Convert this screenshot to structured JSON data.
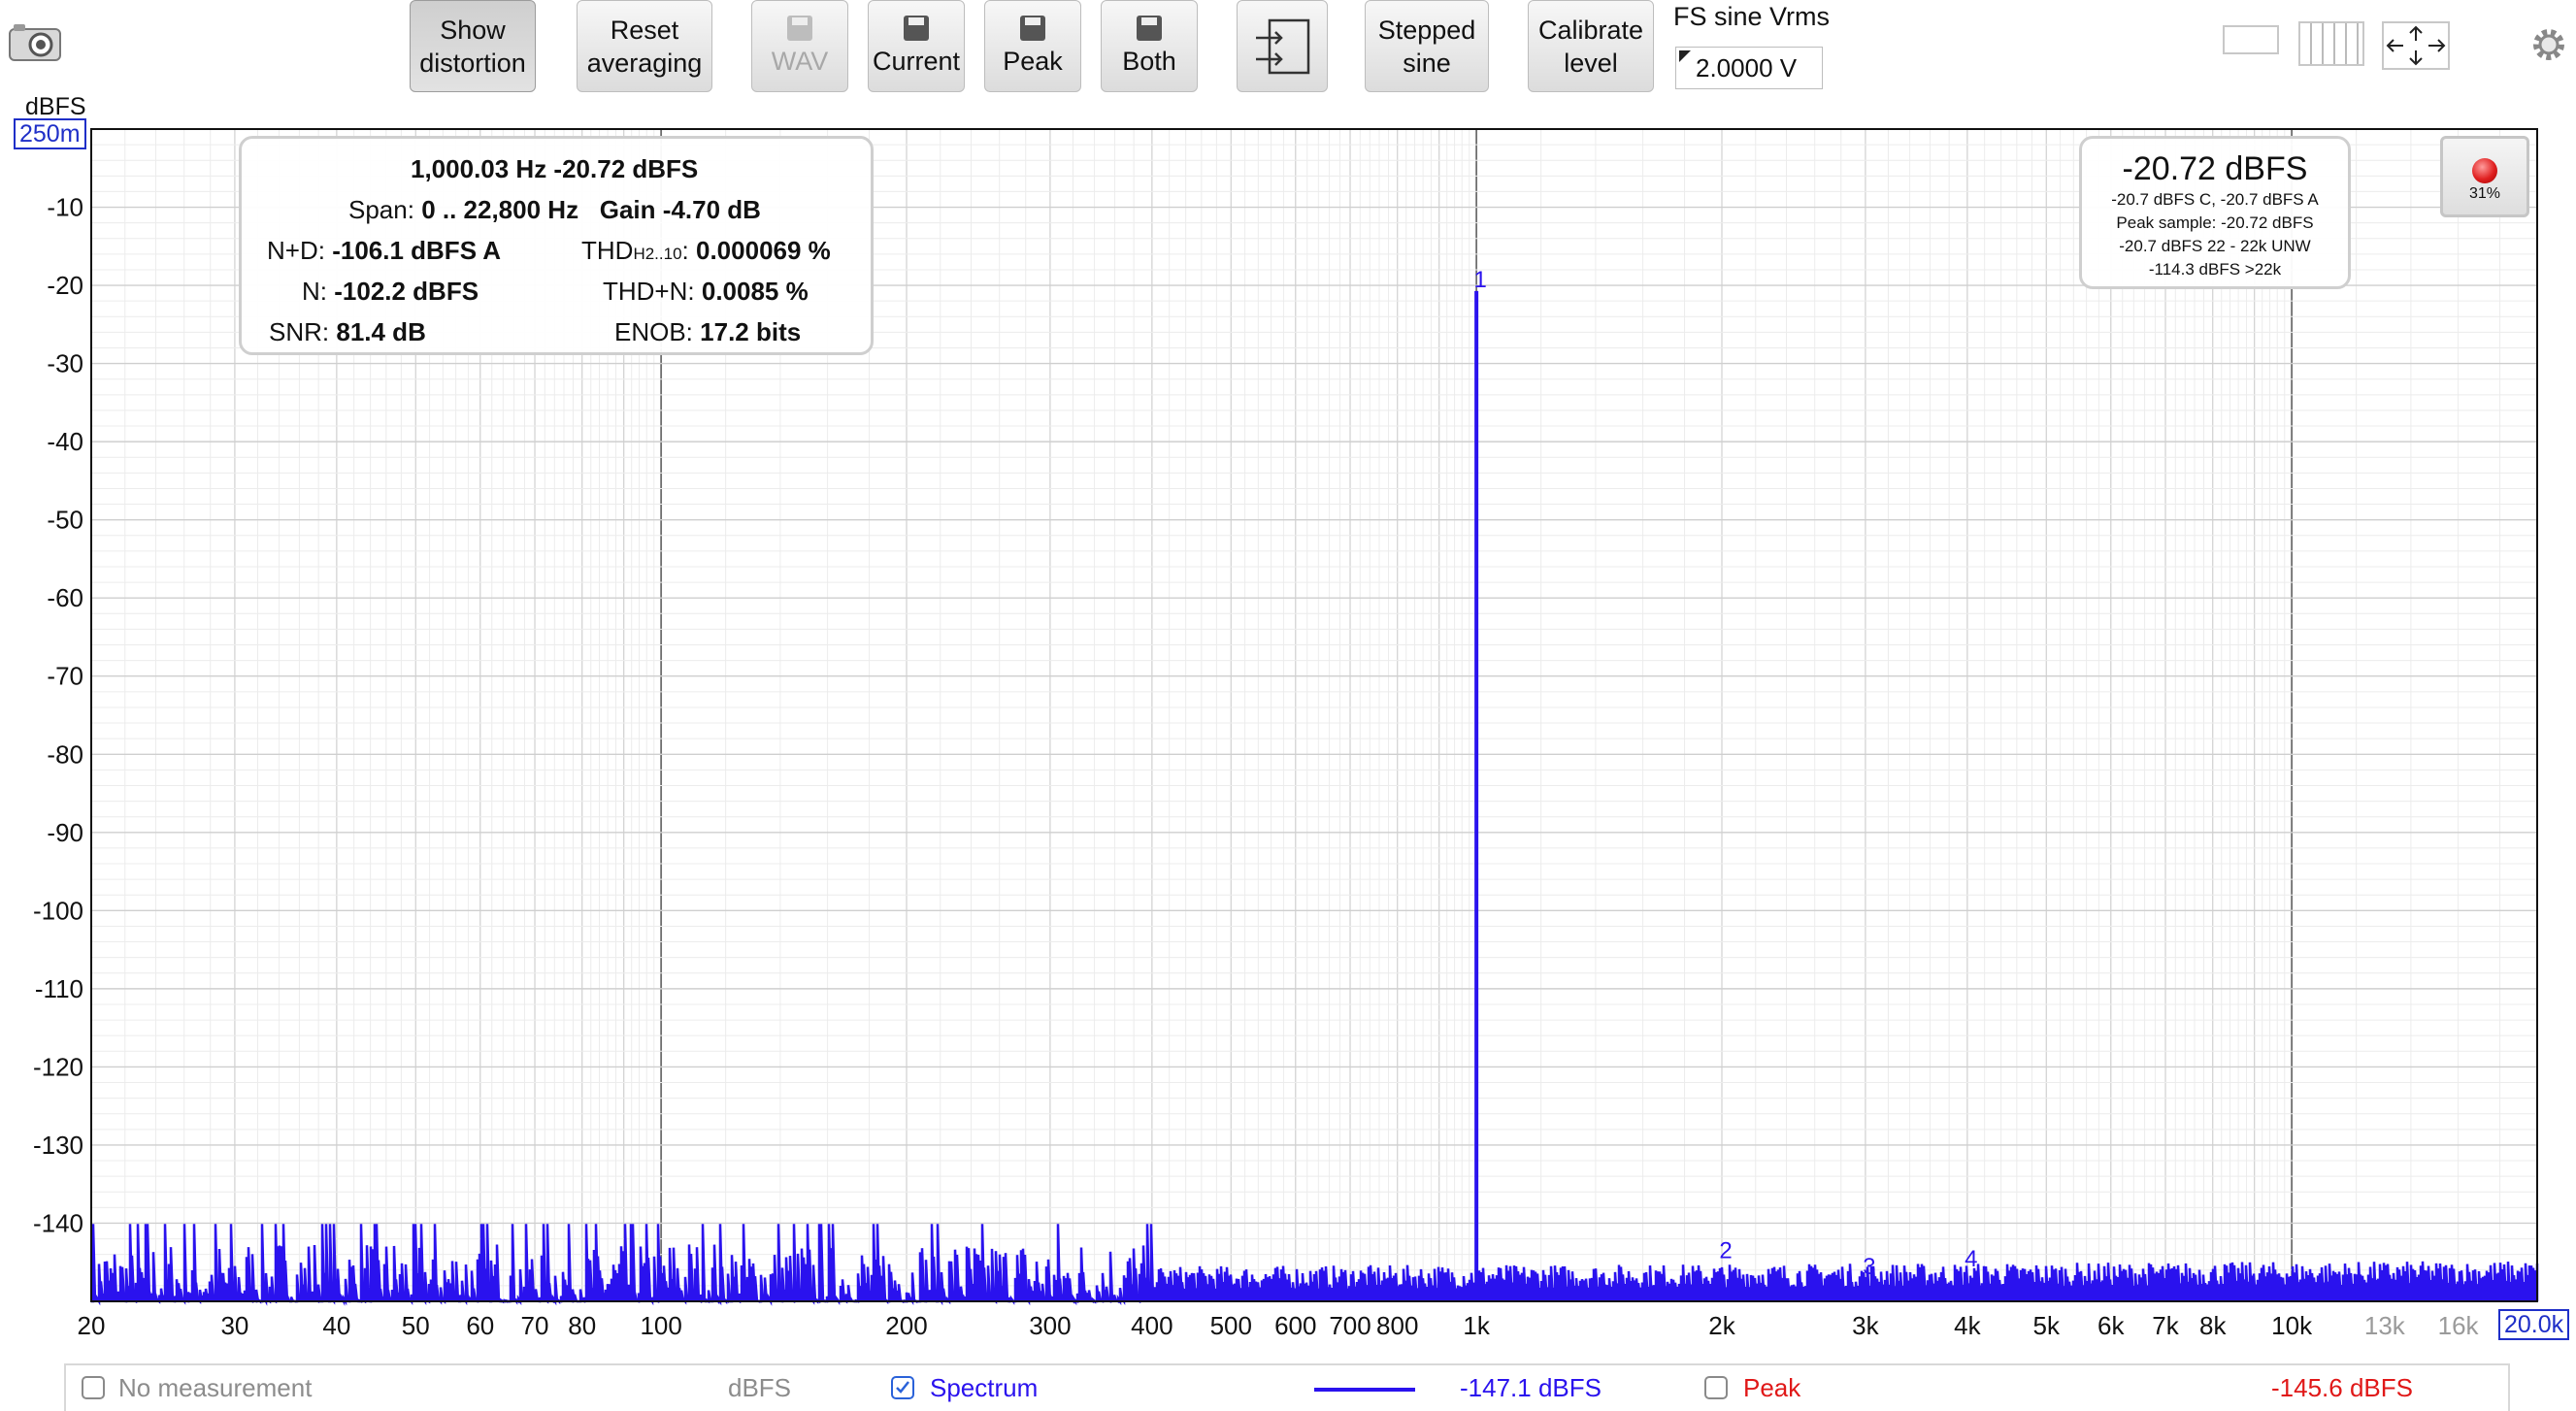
{
  "toolbar": {
    "show_distortion": [
      "Show",
      "distortion"
    ],
    "reset_averaging": [
      "Reset",
      "averaging"
    ],
    "wav_label": "WAV",
    "current_label": "Current",
    "peak_label": "Peak",
    "both_label": "Both",
    "stepped_sine": [
      "Stepped",
      "sine"
    ],
    "calibrate_level": [
      "Calibrate",
      "level"
    ],
    "fs_label": "FS sine Vrms",
    "fs_value": "2.0000 V"
  },
  "stats": {
    "freq_level": "1,000.03 Hz  -20.72 dBFS",
    "span_label": "Span:",
    "span_value": "0 .. 22,800 Hz",
    "gain_label": "Gain",
    "gain_value": "-4.70 dB",
    "nd_label": "N+D:",
    "nd_value": "-106.1 dBFS A",
    "thd_label_main": "THD",
    "thd_label_sub": "H2..10",
    "thd_label_colon": ":",
    "thd_value": "0.000069 %",
    "n_label": "N:",
    "n_value": "-102.2 dBFS",
    "thdn_label": "THD+N:",
    "thdn_value": "0.0085 %",
    "snr_label": "SNR:",
    "snr_value": "81.4 dB",
    "enob_label": "ENOB:",
    "enob_value": "17.2 bits"
  },
  "level_panel": {
    "main": "-20.72 dBFS",
    "line1": "-20.7 dBFS C, -20.7 dBFS A",
    "line2": "Peak sample: -20.72 dBFS",
    "line3": "-20.7 dBFS 22 - 22k UNW",
    "line4": "-114.3 dBFS >22k"
  },
  "record": {
    "percent": "31%",
    "color": "#e02020"
  },
  "chart_data": {
    "type": "line",
    "title": "",
    "ylabel": "dBFS",
    "y_top_label": "250m",
    "x_end_label": "20.0k",
    "x_scale": "log",
    "xlim": [
      20,
      20000
    ],
    "ylim": [
      -150,
      0
    ],
    "y_ticks": [
      -10,
      -20,
      -30,
      -40,
      -50,
      -60,
      -70,
      -80,
      -90,
      -100,
      -110,
      -120,
      -130,
      -140
    ],
    "x_ticks": [
      {
        "v": 20,
        "label": "20"
      },
      {
        "v": 30,
        "label": "30"
      },
      {
        "v": 40,
        "label": "40"
      },
      {
        "v": 50,
        "label": "50"
      },
      {
        "v": 60,
        "label": "60"
      },
      {
        "v": 70,
        "label": "70"
      },
      {
        "v": 80,
        "label": "80"
      },
      {
        "v": 100,
        "label": "100"
      },
      {
        "v": 200,
        "label": "200"
      },
      {
        "v": 300,
        "label": "300"
      },
      {
        "v": 400,
        "label": "400"
      },
      {
        "v": 500,
        "label": "500"
      },
      {
        "v": 600,
        "label": "600"
      },
      {
        "v": 700,
        "label": "700"
      },
      {
        "v": 800,
        "label": "800"
      },
      {
        "v": 1000,
        "label": "1k"
      },
      {
        "v": 2000,
        "label": "2k"
      },
      {
        "v": 3000,
        "label": "3k"
      },
      {
        "v": 4000,
        "label": "4k"
      },
      {
        "v": 5000,
        "label": "5k"
      },
      {
        "v": 6000,
        "label": "6k"
      },
      {
        "v": 7000,
        "label": "7k"
      },
      {
        "v": 8000,
        "label": "8k"
      },
      {
        "v": 10000,
        "label": "10k"
      },
      {
        "v": 13000,
        "label": "13k"
      },
      {
        "v": 16000,
        "label": "16k"
      }
    ],
    "grid": true,
    "series": [
      {
        "name": "Spectrum",
        "color": "#2a12ee",
        "noise_floor": -147.1,
        "peaks": [
          {
            "x": 1000,
            "y": -20.72
          }
        ]
      }
    ],
    "harmonic_markers": [
      {
        "label": "1",
        "x": 1000,
        "y": -20.72
      },
      {
        "label": "2",
        "x": 2000,
        "y": -145
      },
      {
        "label": "3",
        "x": 3000,
        "y": -147
      },
      {
        "label": "4",
        "x": 4000,
        "y": -146
      }
    ]
  },
  "footer": {
    "no_measurement": "No measurement",
    "unit": "dBFS",
    "spectrum_label": "Spectrum",
    "spectrum_value": "-147.1 dBFS",
    "spectrum_color": "#2a12ee",
    "peak_label": "Peak",
    "peak_value": "-145.6 dBFS",
    "peak_color": "#e01818"
  }
}
